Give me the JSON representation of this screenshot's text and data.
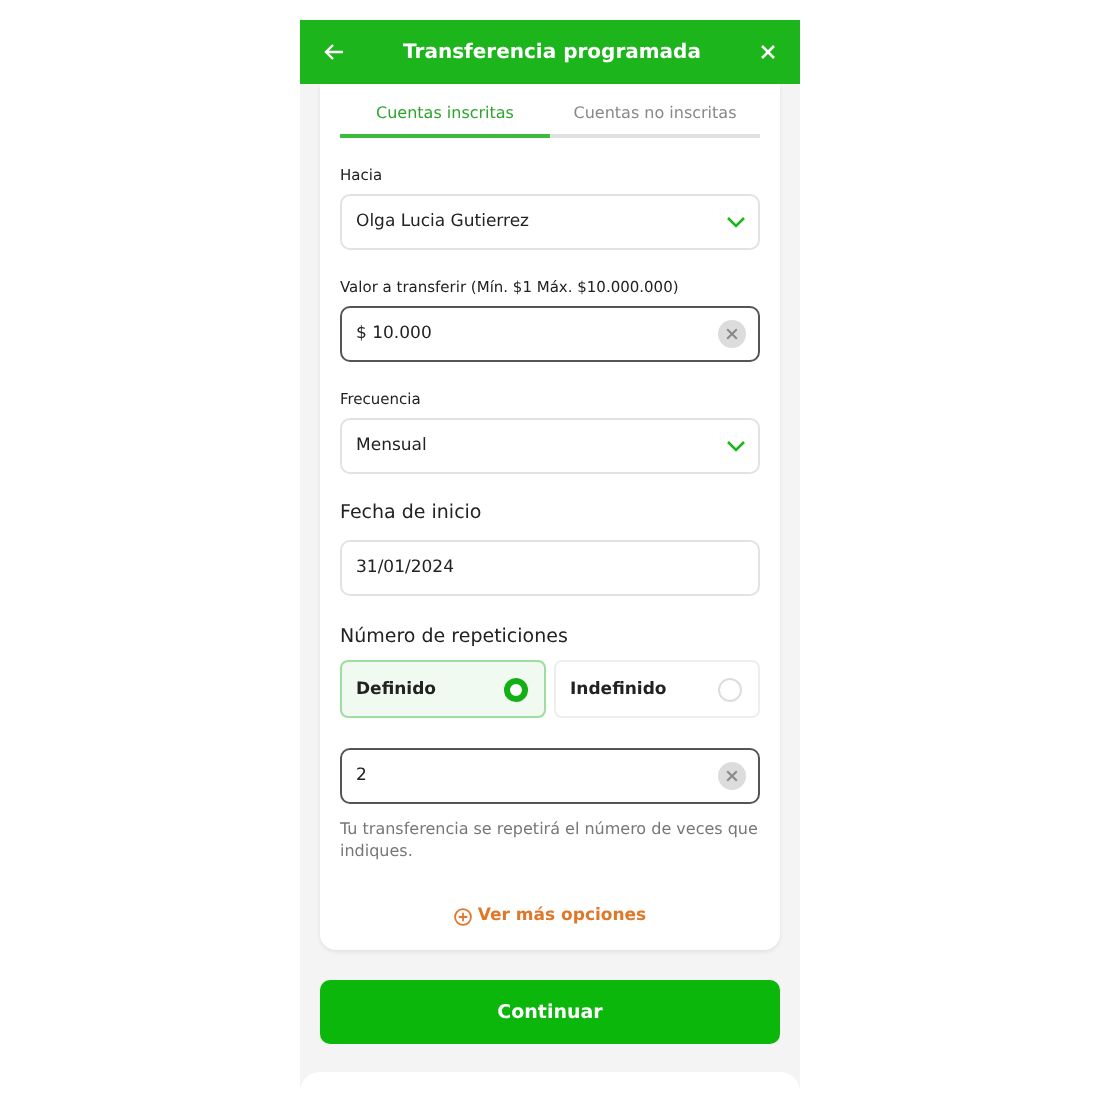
{
  "header": {
    "title": "Transferencia programada"
  },
  "tabs": [
    {
      "label": "Cuentas inscritas",
      "selected": true
    },
    {
      "label": "Cuentas no inscritas",
      "selected": false
    }
  ],
  "fields": [
    {
      "kind": "select",
      "label": "Hacia",
      "value": "Olga Lucia Gutierrez"
    },
    {
      "kind": "clearable",
      "label": "Valor a transferir (Mín. $1 Máx. $10.000.000)",
      "value": "$ 10.000"
    },
    {
      "kind": "select",
      "label": "Frecuencia",
      "value": "Mensual"
    },
    {
      "kind": "text",
      "label": "Fecha de inicio",
      "value": "31/01/2024"
    }
  ],
  "repetitions": {
    "label": "Número de repeticiones",
    "options": [
      {
        "label": "Definido",
        "selected": true
      },
      {
        "label": "Indefinido",
        "selected": false
      }
    ],
    "count": "2",
    "hint": "Tu transferencia se repetirá el número de veces que indiques."
  },
  "more_link": "Ver más opciones",
  "continue_button": "Continuar"
}
